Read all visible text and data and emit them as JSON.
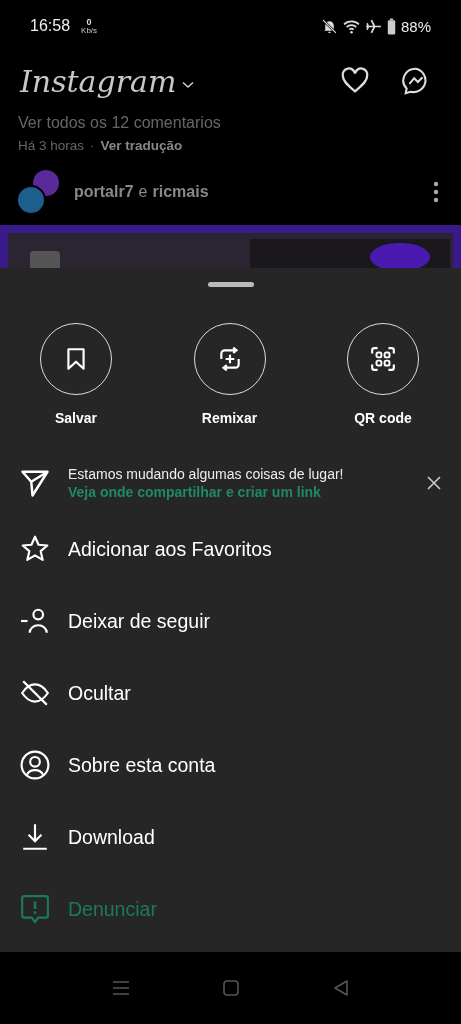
{
  "status_bar": {
    "time": "16:58",
    "net_speed": "0",
    "net_unit": "Kb/s",
    "battery": "88%"
  },
  "header": {
    "title": "Instagram"
  },
  "feed": {
    "comments_link": "Ver todos os 12 comentarios",
    "time_ago": "Há 3 horas",
    "separator": "·",
    "translate_link": "Ver tradução",
    "post": {
      "author": "portalr7",
      "joiner": "e",
      "coauthor": "ricmais"
    }
  },
  "sheet": {
    "actions": [
      {
        "kind": "bookmark",
        "label": "Salvar"
      },
      {
        "kind": "remix",
        "label": "Remixar"
      },
      {
        "kind": "qr",
        "label": "QR code"
      }
    ],
    "notice": {
      "text": "Estamos mudando algumas coisas de lugar!",
      "link": "Veja onde compartilhar e criar um link"
    },
    "items": [
      {
        "kind": "star",
        "label": "Adicionar aos Favoritos",
        "danger": false
      },
      {
        "kind": "unfollow",
        "label": "Deixar de seguir",
        "danger": false
      },
      {
        "kind": "hide",
        "label": "Ocultar",
        "danger": false
      },
      {
        "kind": "account",
        "label": "Sobre esta conta",
        "danger": false
      },
      {
        "kind": "download",
        "label": "Download",
        "danger": false
      },
      {
        "kind": "report",
        "label": "Denunciar",
        "danger": true
      }
    ]
  }
}
